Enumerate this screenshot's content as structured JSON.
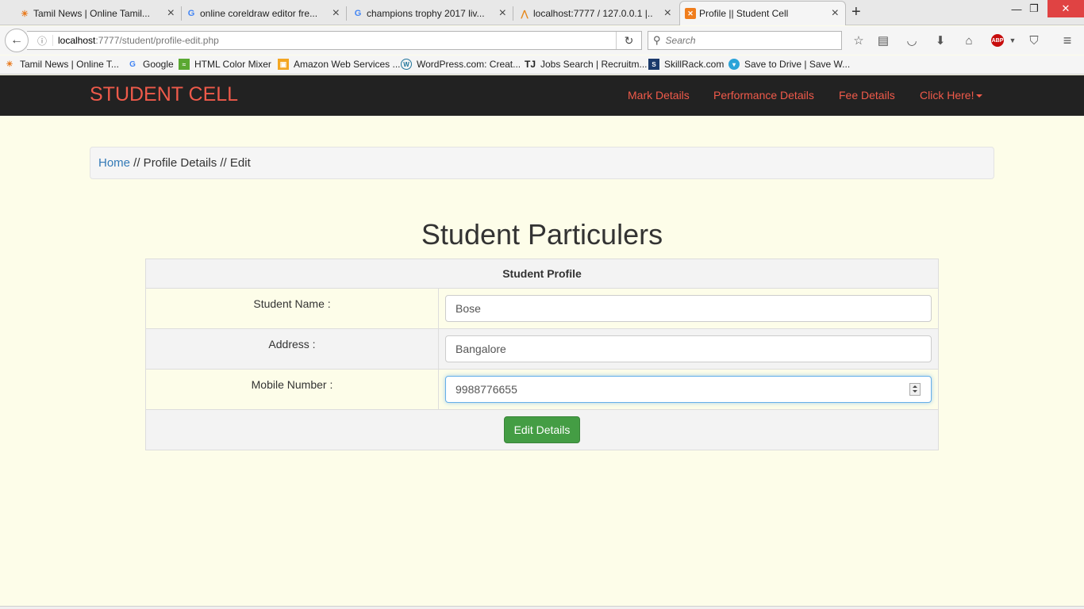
{
  "browser": {
    "tabs": [
      {
        "title": "Tamil News | Online Tamil...",
        "icon": "tamil-news-favicon"
      },
      {
        "title": "online coreldraw editor fre...",
        "icon": "google-favicon"
      },
      {
        "title": "champions trophy 2017 liv...",
        "icon": "google-favicon"
      },
      {
        "title": "localhost:7777 / 127.0.0.1 |...",
        "icon": "phpmyadmin-favicon"
      },
      {
        "title": "Profile || Student Cell",
        "icon": "xampp-favicon"
      }
    ],
    "url_host": "localhost",
    "url_path": ":7777/student/profile-edit.php",
    "search_placeholder": "Search",
    "bookmarks": [
      {
        "label": "Tamil News | Online T...",
        "icon": "tamil-news-favicon"
      },
      {
        "label": "Google",
        "icon": "google-favicon"
      },
      {
        "label": "HTML Color Mixer",
        "icon": "color-mixer-favicon"
      },
      {
        "label": "Amazon Web Services ...",
        "icon": "aws-favicon"
      },
      {
        "label": "WordPress.com: Creat...",
        "icon": "wordpress-favicon"
      },
      {
        "label": "Jobs Search | Recruitm...",
        "icon": "timesjobs-favicon"
      },
      {
        "label": "SkillRack.com",
        "icon": "skillrack-favicon"
      },
      {
        "label": "Save to Drive | Save W...",
        "icon": "drive-favicon"
      }
    ]
  },
  "site": {
    "brand": "STUDENT CELL",
    "nav": {
      "mark": "Mark Details",
      "performance": "Performance Details",
      "fee": "Fee Details",
      "click": "Click Here!"
    },
    "breadcrumb": {
      "home": "Home",
      "rest": " // Profile Details // Edit"
    },
    "title": "Student Particulers",
    "table_header": "Student Profile",
    "fields": {
      "name_label": "Student Name :",
      "name_value": "Bose",
      "address_label": "Address :",
      "address_value": "Bangalore",
      "mobile_label": "Mobile Number :",
      "mobile_value": "9988776655"
    },
    "submit_label": "Edit Details"
  },
  "colors": {
    "brand": "#ee5a4a",
    "navbar_bg": "#222222",
    "page_bg": "#fdfde9",
    "button_green": "#449d44"
  }
}
